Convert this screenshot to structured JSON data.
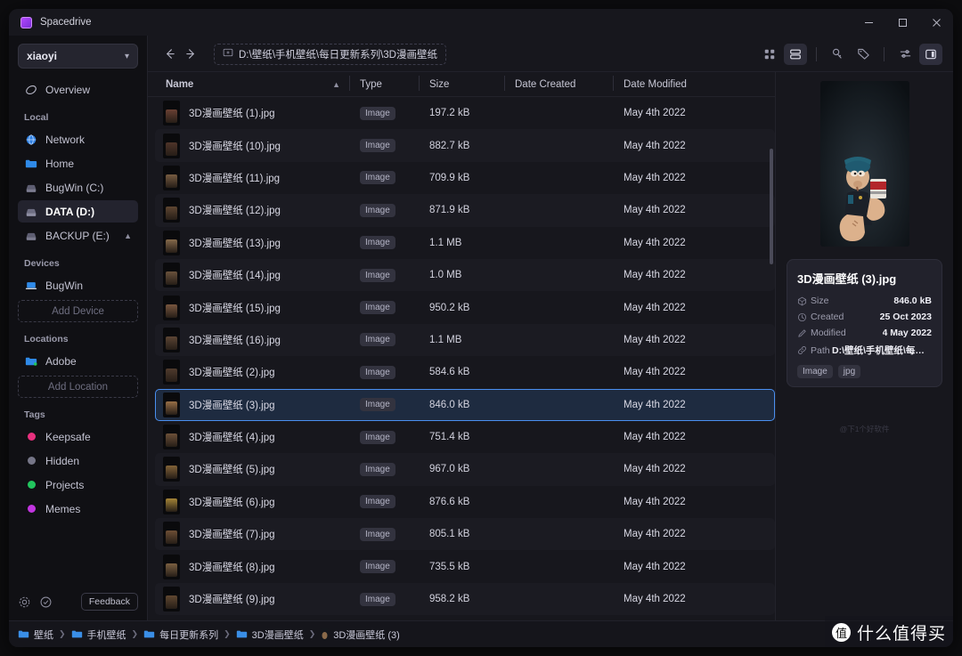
{
  "window": {
    "title": "Spacedrive",
    "controls": {
      "minimize": "minimize-button",
      "maximize": "maximize-button",
      "close": "close-button"
    }
  },
  "sidebar": {
    "library": "xiaoyi",
    "overview": "Overview",
    "sections": [
      {
        "title": "Local",
        "items": [
          {
            "label": "Network",
            "icon": "globe-icon"
          },
          {
            "label": "Home",
            "icon": "folder-icon"
          },
          {
            "label": "BugWin (C:)",
            "icon": "drive-icon"
          },
          {
            "label": "DATA (D:)",
            "icon": "drive-icon",
            "active": true
          },
          {
            "label": "BACKUP (E:)",
            "icon": "drive-icon",
            "eject": true
          }
        ]
      },
      {
        "title": "Devices",
        "items": [
          {
            "label": "BugWin",
            "icon": "laptop-icon"
          }
        ],
        "action": "Add Device"
      },
      {
        "title": "Locations",
        "items": [
          {
            "label": "Adobe",
            "icon": "folder-icon"
          }
        ],
        "action": "Add Location"
      },
      {
        "title": "Tags",
        "items": [
          {
            "label": "Keepsafe",
            "color": "#e8307e"
          },
          {
            "label": "Hidden",
            "color": "#767688"
          },
          {
            "label": "Projects",
            "color": "#22c55e"
          },
          {
            "label": "Memes",
            "color": "#c235e0"
          }
        ]
      }
    ],
    "footer": {
      "settings": "gear-icon",
      "jobs": "check-circle-icon",
      "feedback": "Feedback"
    }
  },
  "topbar": {
    "back": "back-arrow-icon",
    "forward": "forward-arrow-icon",
    "path": "D:\\壁纸\\手机壁纸\\每日更新系列\\3D漫画壁纸",
    "icons": [
      {
        "name": "grid-view-icon",
        "active": false
      },
      {
        "name": "list-view-icon",
        "active": true
      },
      {
        "name": "key-icon",
        "active": false
      },
      {
        "name": "tag-icon",
        "active": false
      },
      {
        "name": "options-sliders-icon",
        "active": false
      },
      {
        "name": "inspector-panel-icon",
        "active": true
      }
    ]
  },
  "table": {
    "columns": [
      "Name",
      "Type",
      "Size",
      "Date Created",
      "Date Modified"
    ],
    "sort": "ascending",
    "rows": [
      {
        "name": "3D漫画壁纸 (1).jpg",
        "type": "Image",
        "size": "197.2 kB",
        "created": "",
        "modified": "May 4th 2022"
      },
      {
        "name": "3D漫画壁纸 (10).jpg",
        "type": "Image",
        "size": "882.7 kB",
        "created": "",
        "modified": "May 4th 2022"
      },
      {
        "name": "3D漫画壁纸 (11).jpg",
        "type": "Image",
        "size": "709.9 kB",
        "created": "",
        "modified": "May 4th 2022"
      },
      {
        "name": "3D漫画壁纸 (12).jpg",
        "type": "Image",
        "size": "871.9 kB",
        "created": "",
        "modified": "May 4th 2022"
      },
      {
        "name": "3D漫画壁纸 (13).jpg",
        "type": "Image",
        "size": "1.1 MB",
        "created": "",
        "modified": "May 4th 2022"
      },
      {
        "name": "3D漫画壁纸 (14).jpg",
        "type": "Image",
        "size": "1.0 MB",
        "created": "",
        "modified": "May 4th 2022"
      },
      {
        "name": "3D漫画壁纸 (15).jpg",
        "type": "Image",
        "size": "950.2 kB",
        "created": "",
        "modified": "May 4th 2022"
      },
      {
        "name": "3D漫画壁纸 (16).jpg",
        "type": "Image",
        "size": "1.1 MB",
        "created": "",
        "modified": "May 4th 2022"
      },
      {
        "name": "3D漫画壁纸 (2).jpg",
        "type": "Image",
        "size": "584.6 kB",
        "created": "",
        "modified": "May 4th 2022"
      },
      {
        "name": "3D漫画壁纸 (3).jpg",
        "type": "Image",
        "size": "846.0 kB",
        "created": "",
        "modified": "May 4th 2022",
        "selected": true
      },
      {
        "name": "3D漫画壁纸 (4).jpg",
        "type": "Image",
        "size": "751.4 kB",
        "created": "",
        "modified": "May 4th 2022"
      },
      {
        "name": "3D漫画壁纸 (5).jpg",
        "type": "Image",
        "size": "967.0 kB",
        "created": "",
        "modified": "May 4th 2022"
      },
      {
        "name": "3D漫画壁纸 (6).jpg",
        "type": "Image",
        "size": "876.6 kB",
        "created": "",
        "modified": "May 4th 2022"
      },
      {
        "name": "3D漫画壁纸 (7).jpg",
        "type": "Image",
        "size": "805.1 kB",
        "created": "",
        "modified": "May 4th 2022"
      },
      {
        "name": "3D漫画壁纸 (8).jpg",
        "type": "Image",
        "size": "735.5 kB",
        "created": "",
        "modified": "May 4th 2022"
      },
      {
        "name": "3D漫画壁纸 (9).jpg",
        "type": "Image",
        "size": "958.2 kB",
        "created": "",
        "modified": "May 4th 2022"
      }
    ]
  },
  "inspector": {
    "filename": "3D漫画壁纸 (3).jpg",
    "meta": [
      {
        "icon": "size-icon",
        "key": "Size",
        "value": "846.0 kB"
      },
      {
        "icon": "clock-icon",
        "key": "Created",
        "value": "25 Oct 2023"
      },
      {
        "icon": "pencil-icon",
        "key": "Modified",
        "value": "4 May 2022"
      },
      {
        "icon": "link-icon",
        "key": "Path",
        "value": "D:\\壁纸\\手机壁纸\\每日更..."
      }
    ],
    "tags": [
      "Image",
      "jpg"
    ],
    "watermark": "@下1个好软件"
  },
  "footer": {
    "breadcrumb": [
      "壁纸",
      "手机壁纸",
      "每日更新系列",
      "3D漫画壁纸"
    ],
    "current": "3D漫画壁纸 (3)",
    "watermark": {
      "badge": "值",
      "text": "什么值得买"
    }
  },
  "colors": {
    "accent": "#4a8ff0",
    "folder": "#3a8ee6",
    "selection_bg": "#1e2b40"
  }
}
